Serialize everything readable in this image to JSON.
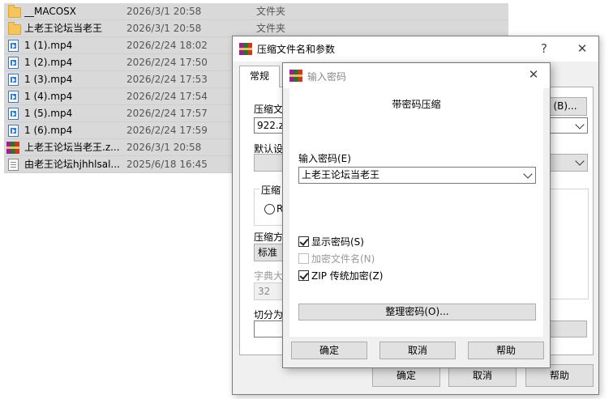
{
  "files": [
    {
      "name": "__MACOSX",
      "date": "2026/3/1 20:58",
      "type": "文件夹",
      "icon": "folder-icon"
    },
    {
      "name": "上老王论坛当老王",
      "date": "2026/3/1 20:58",
      "type": "文件夹",
      "icon": "folder-icon"
    },
    {
      "name": "1 (1).mp4",
      "date": "2026/2/24 18:02",
      "type": "",
      "icon": "video-file-icon"
    },
    {
      "name": "1 (2).mp4",
      "date": "2026/2/24 17:50",
      "type": "",
      "icon": "video-file-icon"
    },
    {
      "name": "1 (3).mp4",
      "date": "2026/2/24 17:53",
      "type": "",
      "icon": "video-file-icon"
    },
    {
      "name": "1 (4).mp4",
      "date": "2026/2/24 17:54",
      "type": "",
      "icon": "video-file-icon"
    },
    {
      "name": "1 (5).mp4",
      "date": "2026/2/24 17:57",
      "type": "",
      "icon": "video-file-icon"
    },
    {
      "name": "1 (6).mp4",
      "date": "2026/2/24 17:59",
      "type": "",
      "icon": "video-file-icon"
    },
    {
      "name": "上老王论坛当老王.z...",
      "date": "2026/3/1 20:58",
      "type": "",
      "icon": "winrar-archive-icon"
    },
    {
      "name": "由老王论坛hjhhlsal...",
      "date": "2025/6/18 16:45",
      "type": "",
      "icon": "text-file-icon"
    }
  ],
  "archive_dialog": {
    "title": "压缩文件名和参数",
    "help_glyph": "?",
    "close_glyph": "✕",
    "tab_general": "常规",
    "archive_name_label": "压缩文",
    "archive_name_value": "922.zip",
    "browse_button": "(B)...",
    "default_profile_label": "默认设",
    "format_group_label": "压缩",
    "format_radio_label": "R",
    "method_label": "压缩方",
    "method_value": "标准",
    "dict_label": "字典大",
    "dict_value": "32",
    "split_label": "切分为",
    "ok": "确定",
    "cancel": "取消",
    "help": "帮助"
  },
  "password_dialog": {
    "title": "输入密码",
    "close_glyph": "✕",
    "heading": "带密码压缩",
    "password_label": "输入密码(E)",
    "password_value": "上老王论坛当老王",
    "show_password": {
      "label": "显示密码(S)",
      "checked": true
    },
    "encrypt_names": {
      "label": "加密文件名(N)",
      "checked": false,
      "disabled": true
    },
    "zip_legacy": {
      "label": "ZIP 传统加密(Z)",
      "checked": true
    },
    "organize_button": "整理密码(O)...",
    "ok": "确定",
    "cancel": "取消",
    "help": "帮助"
  }
}
